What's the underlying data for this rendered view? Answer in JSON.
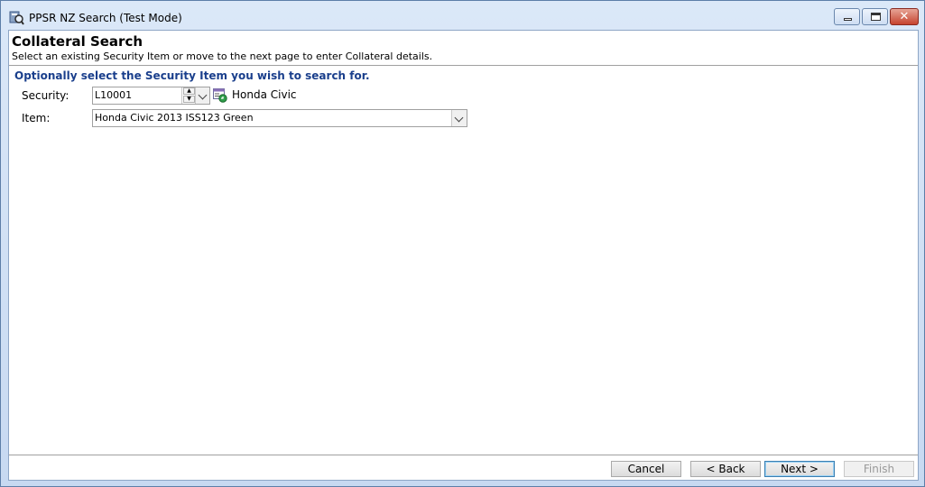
{
  "window": {
    "title": "PPSR NZ Search (Test Mode)",
    "controls": {
      "minimize": "minimize",
      "maximize": "maximize",
      "close": "✕"
    }
  },
  "header": {
    "title": "Collateral Search",
    "subtitle": "Select an existing Security Item or move to the next page to enter Collateral details."
  },
  "form": {
    "instruction": "Optionally select the Security Item you wish to search for.",
    "security": {
      "label": "Security:",
      "value": "L10001",
      "description": "Honda Civic"
    },
    "item": {
      "label": "Item:",
      "value": "Honda Civic 2013 ISS123 Green"
    }
  },
  "buttons": {
    "cancel": "Cancel",
    "back": "< Back",
    "next": "Next >",
    "finish": "Finish"
  },
  "icons": {
    "app": "ppsr-search-app-icon",
    "lookup": "security-lookup-icon"
  },
  "colors": {
    "instruction": "#1a3f8c",
    "default_button_border": "#3c7fb1"
  }
}
